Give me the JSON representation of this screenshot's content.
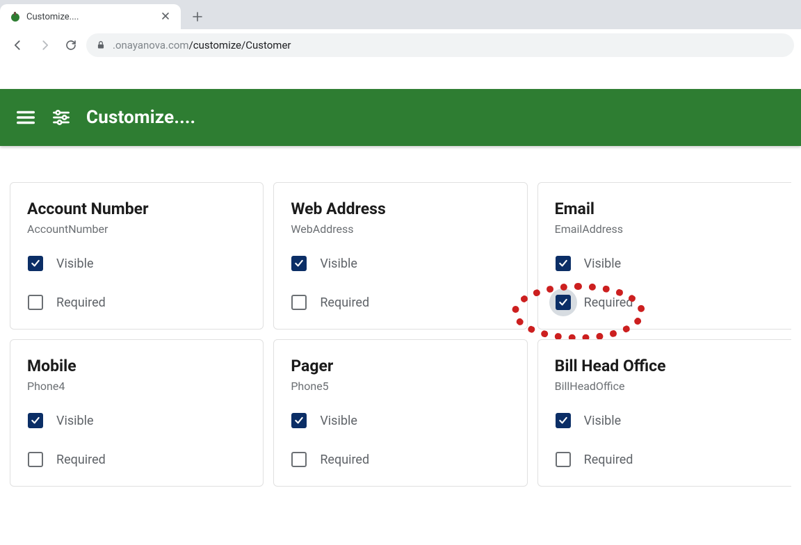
{
  "browser": {
    "tab_title": "Customize....",
    "url_host": ".onayanova.com",
    "url_path": "/customize/Customer"
  },
  "appbar": {
    "title": "Customize...."
  },
  "labels": {
    "visible": "Visible",
    "required": "Required"
  },
  "cards": [
    {
      "title": "Account Number",
      "system": "AccountNumber",
      "visible": true,
      "required": false,
      "highlighted": false
    },
    {
      "title": "Web Address",
      "system": "WebAddress",
      "visible": true,
      "required": false,
      "highlighted": false
    },
    {
      "title": "Email",
      "system": "EmailAddress",
      "visible": true,
      "required": true,
      "highlighted": true
    },
    {
      "title": "Mobile",
      "system": "Phone4",
      "visible": true,
      "required": false,
      "highlighted": false
    },
    {
      "title": "Pager",
      "system": "Phone5",
      "visible": true,
      "required": false,
      "highlighted": false
    },
    {
      "title": "Bill Head Office",
      "system": "BillHeadOffice",
      "visible": true,
      "required": false,
      "highlighted": false
    }
  ],
  "annotation": {
    "target_card_index": 2,
    "target_field": "required"
  }
}
